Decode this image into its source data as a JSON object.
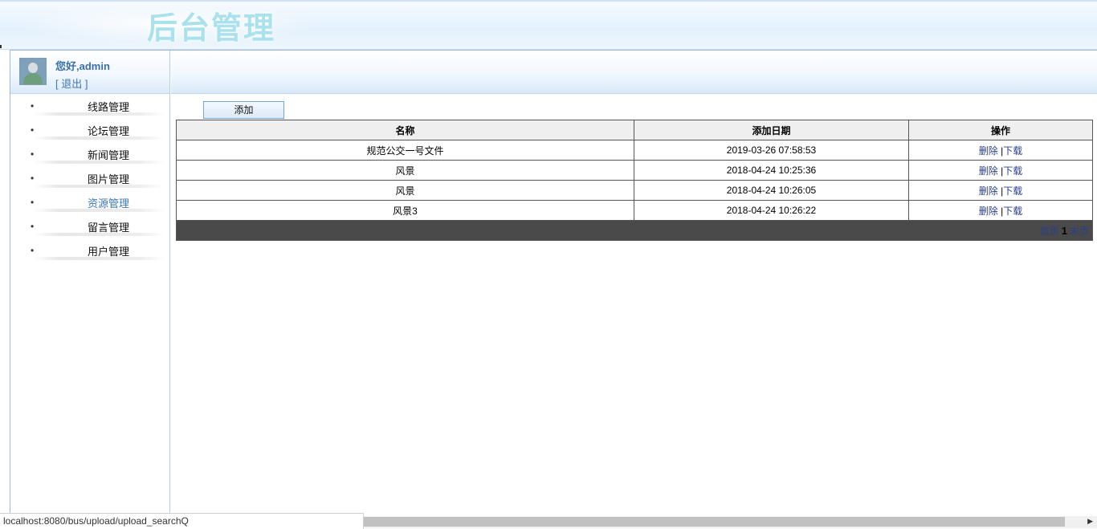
{
  "header": {
    "title": "后台管理"
  },
  "user": {
    "greeting": "您好,admin",
    "logout_label": "[ 退出 ]"
  },
  "nav": {
    "bullet": "•",
    "items": [
      {
        "label": "线路管理",
        "active": false
      },
      {
        "label": "论坛管理",
        "active": false
      },
      {
        "label": "新闻管理",
        "active": false
      },
      {
        "label": "图片管理",
        "active": false
      },
      {
        "label": "资源管理",
        "active": true
      },
      {
        "label": "留言管理",
        "active": false
      },
      {
        "label": "用户管理",
        "active": false
      }
    ]
  },
  "toolbar": {
    "add_label": "添加"
  },
  "table": {
    "columns": [
      "名称",
      "添加日期",
      "操作"
    ],
    "rows": [
      {
        "name": "规范公交一号文件",
        "date": "2019-03-26 07:58:53",
        "delete": "删除",
        "sep": "|",
        "download": "下载"
      },
      {
        "name": "风景",
        "date": "2018-04-24 10:25:36",
        "delete": "删除",
        "sep": "|",
        "download": "下载"
      },
      {
        "name": "风景",
        "date": "2018-04-24 10:26:05",
        "delete": "删除",
        "sep": "|",
        "download": "下载"
      },
      {
        "name": "风景3",
        "date": "2018-04-24 10:26:22",
        "delete": "删除",
        "sep": "|",
        "download": "下载"
      }
    ]
  },
  "pager": {
    "first": "首页",
    "current": "1",
    "last": "末页"
  },
  "statusbar": {
    "url": "localhost:8080/bus/upload/upload_searchQ"
  }
}
